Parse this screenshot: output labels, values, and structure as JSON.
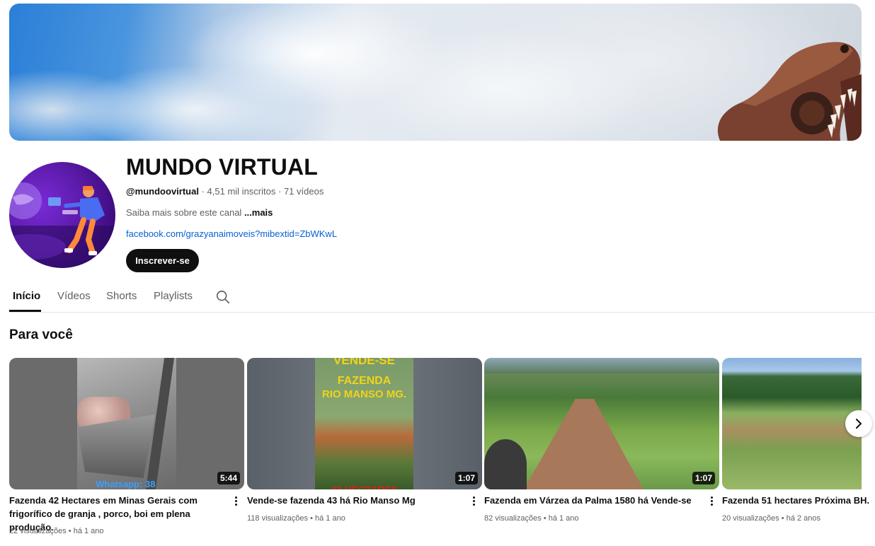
{
  "channel": {
    "title": "MUNDO VIRTUAL",
    "handle": "@mundoovirtual",
    "subscribers": "4,51 mil inscritos",
    "videos_count": "71 vídeos",
    "separator": "·",
    "about": "Saiba mais sobre este canal ",
    "more": "...mais",
    "link": "facebook.com/grazyanaimoveis?mibextid=ZbWKwL",
    "subscribe_label": "Inscrever-se"
  },
  "tabs": [
    {
      "label": "Início",
      "active": true
    },
    {
      "label": "Vídeos",
      "active": false
    },
    {
      "label": "Shorts",
      "active": false
    },
    {
      "label": "Playlists",
      "active": false
    }
  ],
  "section": {
    "title": "Para você"
  },
  "videos": [
    {
      "title": "Fazenda 42 Hectares em Minas Gerais com frigorífico de granja , porco, boi em plena produção.",
      "duration": "5:44",
      "views": "22 visualizações",
      "age": "há 1 ano",
      "overlay_text": "Whatsapp: 38"
    },
    {
      "title": "Vende-se fazenda 43 há Rio Manso Mg",
      "duration": "1:07",
      "views": "118 visualizações",
      "age": "há 1 ano",
      "overlay_top": "VENDE-SE",
      "overlay_mid1": "FAZENDA",
      "overlay_mid2": "RIO MANSO MG.",
      "overlay_bottom": "43 HECTARES"
    },
    {
      "title": "Fazenda em Várzea da Palma 1580 há Vende-se",
      "duration": "1:07",
      "views": "82 visualizações",
      "age": "há 1 ano"
    },
    {
      "title": "Fazenda 51 hectares Próxima BH.",
      "duration": "",
      "views": "20 visualizações",
      "age": "há 2 anos"
    }
  ],
  "meta_dot": "•",
  "icons": {
    "search": "search-icon",
    "more": "more-vert-icon",
    "next": "chevron-right-icon"
  }
}
